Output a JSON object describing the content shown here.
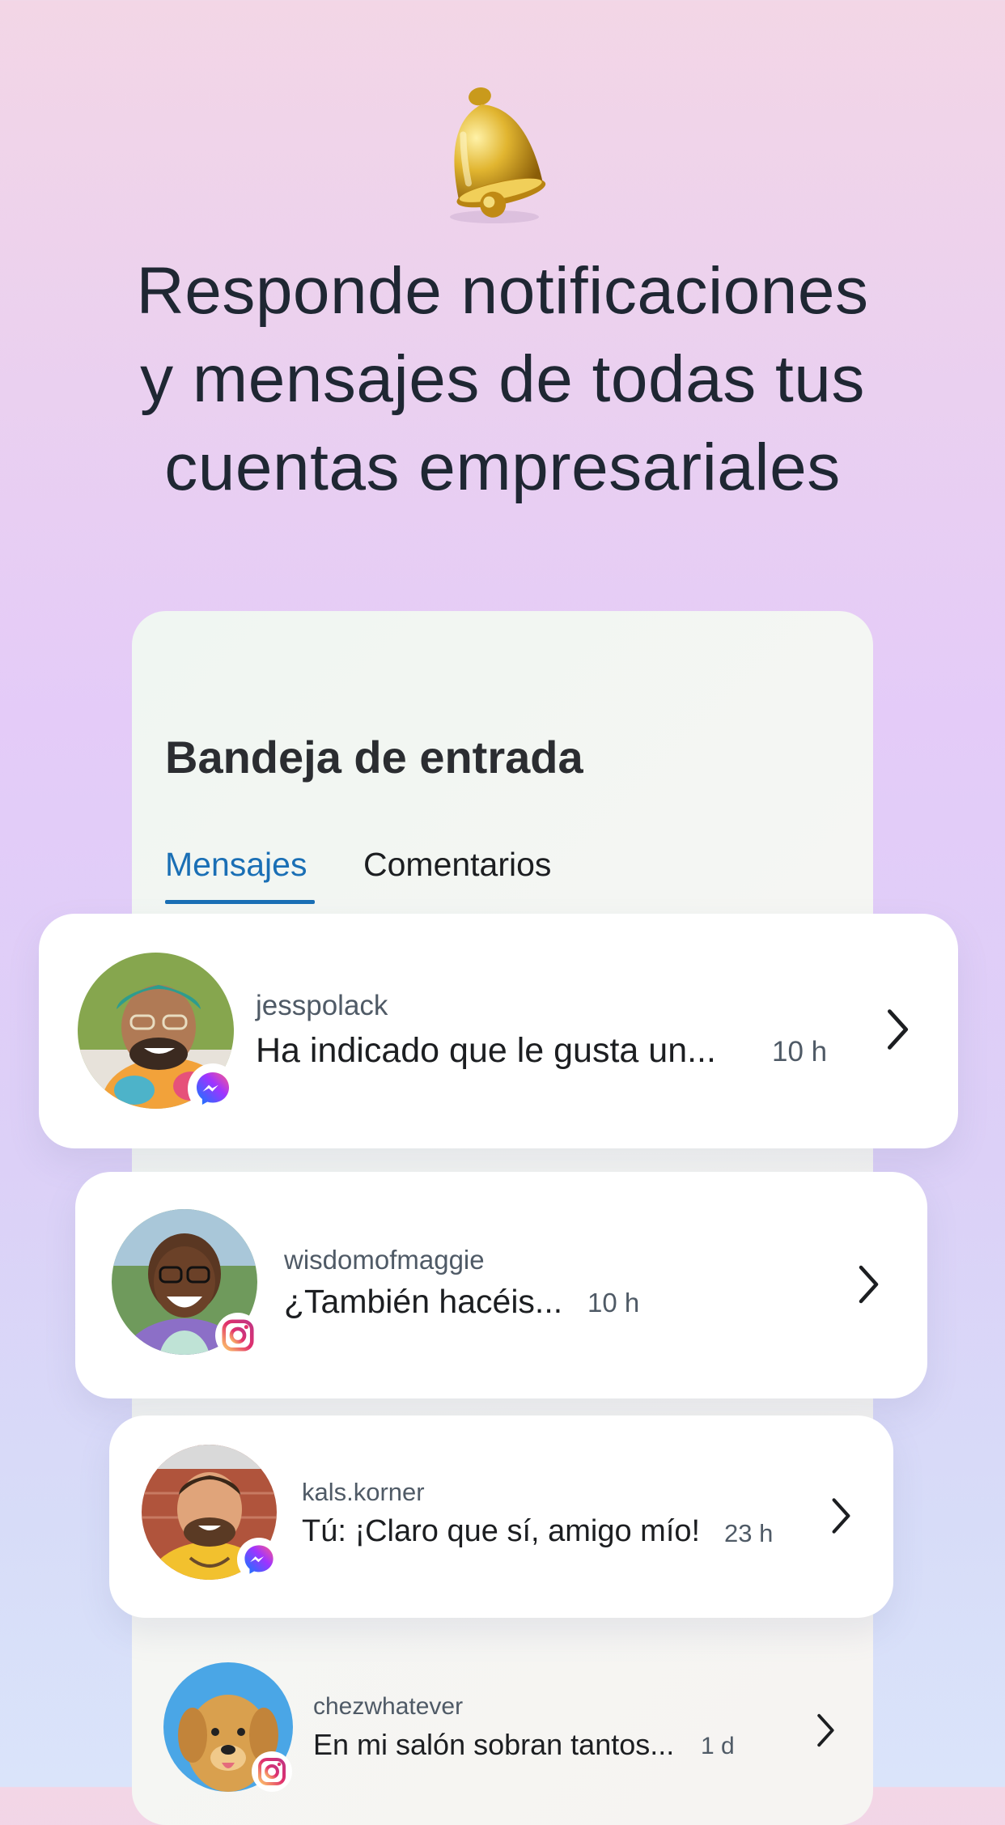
{
  "headline": {
    "line1": "Responde notificaciones",
    "line2": "y mensajes de todas tus",
    "line3": "cuentas empresariales"
  },
  "inbox": {
    "title": "Bandeja de entrada",
    "tabs": [
      {
        "label": "Mensajes",
        "active": true
      },
      {
        "label": "Comentarios",
        "active": false
      }
    ]
  },
  "conversations": [
    {
      "username": "jesspolack",
      "preview": "Ha indicado que le gusta un...",
      "time": "10 h",
      "platform": "messenger-icon"
    },
    {
      "username": "wisdomofmaggie",
      "preview": "¿También hacéis...",
      "time": "10 h",
      "platform": "instagram-icon"
    },
    {
      "username": "kals.korner",
      "preview": "Tú: ¡Claro que sí, amigo mío!",
      "time": "23 h",
      "platform": "messenger-icon"
    },
    {
      "username": "chezwhatever",
      "preview": "En mi salón sobran tantos...",
      "time": "1 d",
      "platform": "instagram-icon"
    }
  ],
  "colors": {
    "accent": "#1a6fb5",
    "heading": "#1f2733",
    "secondary_text": "#4f5a66",
    "messenger_gradient": [
      "#0a7cff",
      "#a033ff",
      "#ff5c87"
    ],
    "instagram_gradient": [
      "#fdc468",
      "#e1306c",
      "#c13584"
    ]
  }
}
